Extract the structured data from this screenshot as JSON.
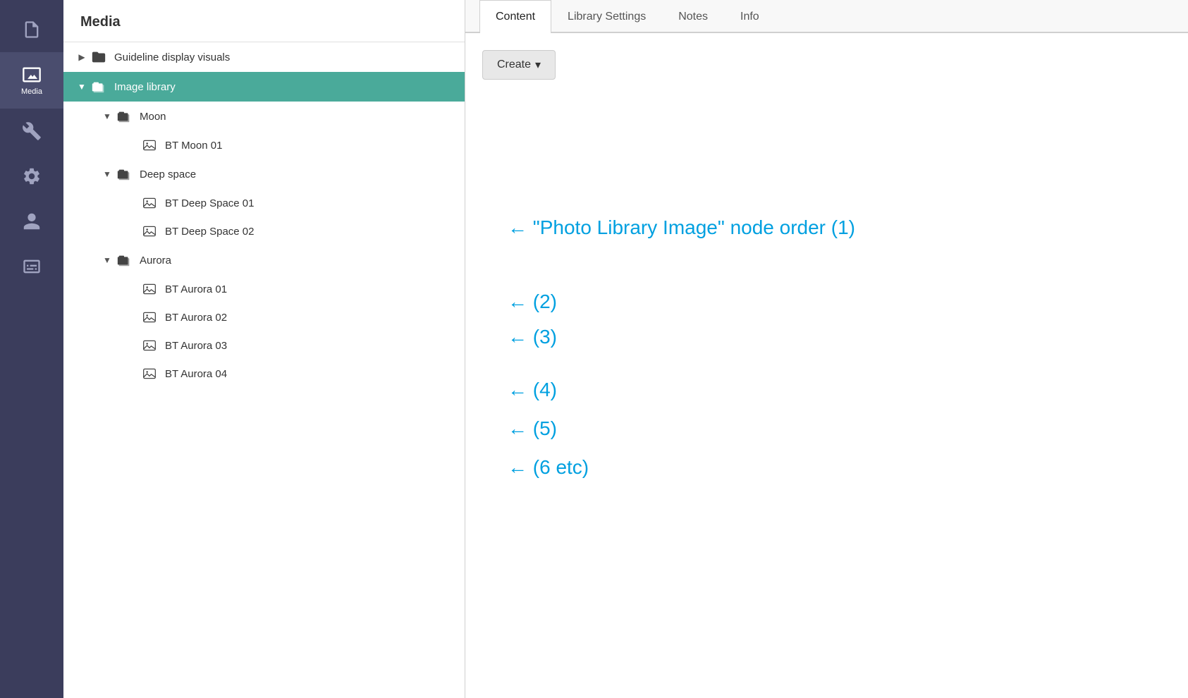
{
  "rail": {
    "items": [
      {
        "id": "document",
        "label": "",
        "active": false
      },
      {
        "id": "media",
        "label": "Media",
        "active": true
      },
      {
        "id": "tools",
        "label": "",
        "active": false
      },
      {
        "id": "settings",
        "label": "",
        "active": false
      },
      {
        "id": "user",
        "label": "",
        "active": false
      },
      {
        "id": "card",
        "label": "",
        "active": false
      }
    ]
  },
  "tree": {
    "header": "Media",
    "nodes": [
      {
        "id": "guideline",
        "label": "Guideline display visuals",
        "type": "folder",
        "indent": 0,
        "expanded": false,
        "selected": false
      },
      {
        "id": "image-library",
        "label": "Image library",
        "type": "library",
        "indent": 0,
        "expanded": true,
        "selected": true
      },
      {
        "id": "moon",
        "label": "Moon",
        "type": "library",
        "indent": 1,
        "expanded": true,
        "selected": false
      },
      {
        "id": "bt-moon-01",
        "label": "BT Moon 01",
        "type": "image",
        "indent": 2,
        "expanded": false,
        "selected": false
      },
      {
        "id": "deep-space",
        "label": "Deep space",
        "type": "library",
        "indent": 1,
        "expanded": true,
        "selected": false
      },
      {
        "id": "bt-deep-space-01",
        "label": "BT Deep Space 01",
        "type": "image",
        "indent": 2,
        "expanded": false,
        "selected": false
      },
      {
        "id": "bt-deep-space-02",
        "label": "BT Deep Space 02",
        "type": "image",
        "indent": 2,
        "expanded": false,
        "selected": false
      },
      {
        "id": "aurora",
        "label": "Aurora",
        "type": "library",
        "indent": 1,
        "expanded": true,
        "selected": false
      },
      {
        "id": "bt-aurora-01",
        "label": "BT Aurora 01",
        "type": "image",
        "indent": 2,
        "expanded": false,
        "selected": false
      },
      {
        "id": "bt-aurora-02",
        "label": "BT Aurora 02",
        "type": "image",
        "indent": 2,
        "expanded": false,
        "selected": false
      },
      {
        "id": "bt-aurora-03",
        "label": "BT Aurora 03",
        "type": "image",
        "indent": 2,
        "expanded": false,
        "selected": false
      },
      {
        "id": "bt-aurora-04",
        "label": "BT Aurora 04",
        "type": "image",
        "indent": 2,
        "expanded": false,
        "selected": false
      }
    ]
  },
  "rightPanel": {
    "tabs": [
      {
        "id": "content",
        "label": "Content",
        "active": true
      },
      {
        "id": "library-settings",
        "label": "Library Settings",
        "active": false
      },
      {
        "id": "notes",
        "label": "Notes",
        "active": false
      },
      {
        "id": "info",
        "label": "Info",
        "active": false
      }
    ],
    "createButton": "Create",
    "annotation": {
      "mainText": "\"Photo Library Image\" node order (1)",
      "arrowLabel": "←",
      "numbers": [
        "← (2)",
        "← (3)",
        "← (4)",
        "← (5)",
        "← (6 etc)"
      ]
    }
  }
}
